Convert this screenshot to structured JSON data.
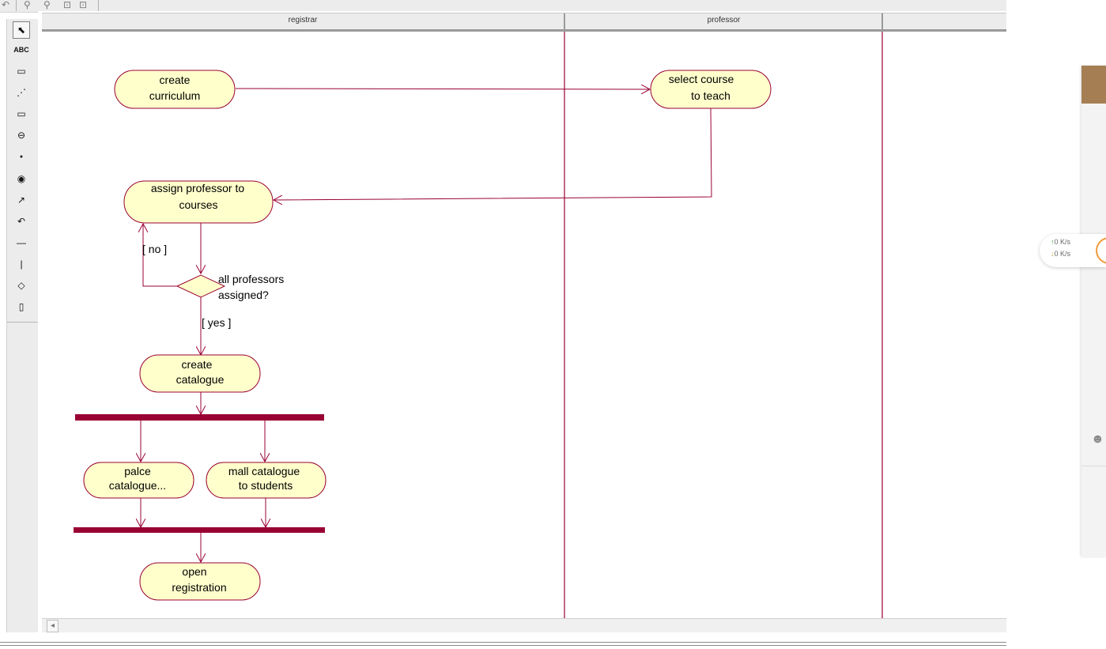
{
  "toolbar": {
    "icons": [
      "undo-icon",
      "zoom-in-icon",
      "zoom-out-icon",
      "fit-icon",
      "print-preview-icon"
    ]
  },
  "palette": {
    "tools": [
      {
        "name": "selection-tool",
        "glyph": "⬉"
      },
      {
        "name": "text-tool",
        "glyph": "ABC"
      },
      {
        "name": "note-tool",
        "glyph": "▭"
      },
      {
        "name": "anchor-note-tool",
        "glyph": "⋰"
      },
      {
        "name": "activity-tool",
        "glyph": "▭"
      },
      {
        "name": "state-tool",
        "glyph": "⊖"
      },
      {
        "name": "start-state-tool",
        "glyph": "●"
      },
      {
        "name": "end-state-tool",
        "glyph": "◉"
      },
      {
        "name": "transition-tool",
        "glyph": "↗"
      },
      {
        "name": "self-transition-tool",
        "glyph": "↶"
      },
      {
        "name": "horizontal-sync-tool",
        "glyph": "—"
      },
      {
        "name": "vertical-sync-tool",
        "glyph": "|"
      },
      {
        "name": "decision-tool",
        "glyph": "◇"
      },
      {
        "name": "swimlane-tool",
        "glyph": "▯"
      }
    ]
  },
  "swimlanes": {
    "registrar": "registrar",
    "professor": "professor"
  },
  "activities": {
    "create_curriculum": [
      "create",
      "curriculum"
    ],
    "select_course": [
      "select course",
      "to teach"
    ],
    "assign_professor": [
      "assign professor to",
      "courses"
    ],
    "create_catalogue": [
      "create",
      "catalogue"
    ],
    "place_catalogue": [
      "palce",
      "catalogue..."
    ],
    "mail_catalogue": [
      "mall catalogue",
      "to students"
    ],
    "open_registration": [
      "open",
      "registration"
    ]
  },
  "decision": {
    "label": [
      "all professors",
      "assigned?"
    ],
    "guard_no": "[ no ]",
    "guard_yes": "[ yes ]"
  },
  "speed_widget": {
    "up": "0  K/s",
    "down": "0  K/s"
  },
  "colors": {
    "activity_fill": "#ffffcc",
    "line": "#990033",
    "sync_bar": "#990033",
    "right_panel_accent": "#a57f53",
    "speed_ring": "#f29a3c"
  }
}
